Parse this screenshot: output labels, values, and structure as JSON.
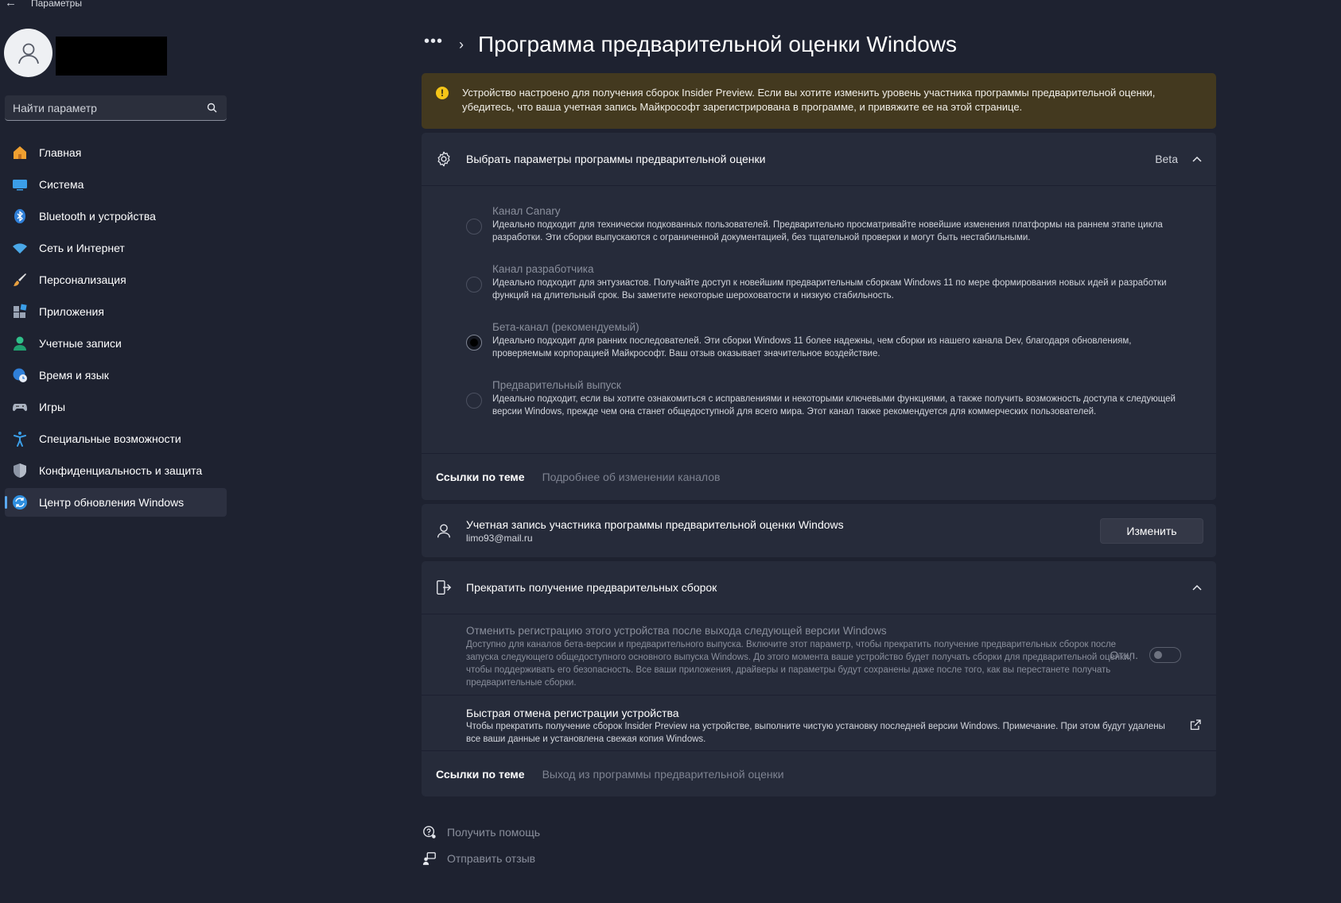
{
  "window": {
    "title": "Параметры",
    "back_icon": "back-arrow-icon"
  },
  "profile": {
    "avatar_icon": "user-avatar-icon"
  },
  "search": {
    "placeholder": "Найти параметр",
    "icon": "search-icon"
  },
  "nav": {
    "items": [
      {
        "label": "Главная",
        "icon": "home-icon"
      },
      {
        "label": "Система",
        "icon": "system-display-icon"
      },
      {
        "label": "Bluetooth и устройства",
        "icon": "bluetooth-icon"
      },
      {
        "label": "Сеть и Интернет",
        "icon": "wifi-icon"
      },
      {
        "label": "Персонализация",
        "icon": "brush-icon"
      },
      {
        "label": "Приложения",
        "icon": "apps-icon"
      },
      {
        "label": "Учетные записи",
        "icon": "account-icon"
      },
      {
        "label": "Время и язык",
        "icon": "time-language-icon"
      },
      {
        "label": "Игры",
        "icon": "gamepad-icon"
      },
      {
        "label": "Специальные возможности",
        "icon": "accessibility-icon"
      },
      {
        "label": "Конфиденциальность и защита",
        "icon": "shield-icon"
      },
      {
        "label": "Центр обновления Windows",
        "icon": "windows-update-icon"
      }
    ],
    "active_index": 11
  },
  "breadcrumb": {
    "dots": "•••",
    "separator": "›",
    "title": "Программа предварительной оценки Windows"
  },
  "warning": {
    "icon": "warning-icon",
    "text": "Устройство настроено для получения сборок Insider Preview. Если вы хотите изменить уровень участника программы предварительной оценки, убедитесь, что ваша учетная запись Майкрософт зарегистрирована в программе, и привяжите ее на этой странице."
  },
  "insider_settings": {
    "icon": "gear-icon",
    "title": "Выбрать параметры программы предварительной оценки",
    "value": "Beta",
    "channels": [
      {
        "title": "Канал Canary",
        "description": "Идеально подходит для технически подкованных пользователей. Предварительно просматривайте новейшие изменения платформы на раннем этапе цикла разработки. Эти сборки выпускаются с ограниченной документацией, без тщательной проверки и могут быть нестабильными.",
        "selected": false
      },
      {
        "title": "Канал разработчика",
        "description": "Идеально подходит для энтузиастов. Получайте доступ к новейшим предварительным сборкам Windows 11 по мере формирования новых идей и разработки функций на длительный срок. Вы заметите некоторые шероховатости и низкую стабильность.",
        "selected": false
      },
      {
        "title": "Бета-канал (рекомендуемый)",
        "description": "Идеально подходит для ранних последователей. Эти сборки Windows 11 более надежны, чем сборки из нашего канала Dev, благодаря обновлениям, проверяемым корпорацией Майкрософт. Ваш отзыв оказывает значительное воздействие.",
        "selected": true
      },
      {
        "title": "Предварительный выпуск",
        "description": "Идеально подходит, если вы хотите ознакомиться с исправлениями и некоторыми ключевыми функциями, а также получить возможность доступа к следующей версии Windows, прежде чем она станет общедоступной для всего мира. Этот канал также рекомендуется для коммерческих пользователей.",
        "selected": false
      }
    ],
    "links_label": "Ссылки по теме",
    "links_link": "Подробнее об изменении каналов"
  },
  "account": {
    "icon": "account-outline-icon",
    "title": "Учетная запись участника программы предварительной оценки Windows",
    "email": "limo93@mail.ru",
    "button": "Изменить"
  },
  "stop_builds": {
    "icon": "exit-device-icon",
    "title": "Прекратить получение предварительных сборок",
    "unenroll_title": "Отменить регистрацию этого устройства после выхода следующей версии Windows",
    "unenroll_desc": "Доступно для каналов бета-версии и предварительного выпуска. Включите этот параметр, чтобы прекратить получение предварительных сборок после запуска следующего общедоступного основного выпуска Windows. До этого момента ваше устройство будет получать сборки для предварительной оценки, чтобы поддерживать его безопасность. Все ваши приложения, драйверы и параметры будут сохранены даже после того, как вы перестанете получать предварительные сборки.",
    "toggle_state": "Откл.",
    "toggle_on": false,
    "fast_title": "Быстрая отмена регистрации устройства",
    "fast_desc": "Чтобы прекратить получение сборок Insider Preview на устройстве, выполните чистую установку последней версии Windows. Примечание. При этом будут удалены все ваши данные и установлена свежая копия Windows.",
    "fast_icon": "external-link-icon",
    "links_label": "Ссылки по теме",
    "links_link": "Выход из программы предварительной оценки"
  },
  "footer": {
    "help": "Получить помощь",
    "help_icon": "help-icon",
    "feedback": "Отправить отзыв",
    "feedback_icon": "feedback-icon"
  },
  "colors": {
    "accent": "#5aa9f0",
    "background": "#1e2230",
    "card": "#262b3a",
    "warning_bg": "#43391f",
    "warning_icon": "#f5c518"
  }
}
